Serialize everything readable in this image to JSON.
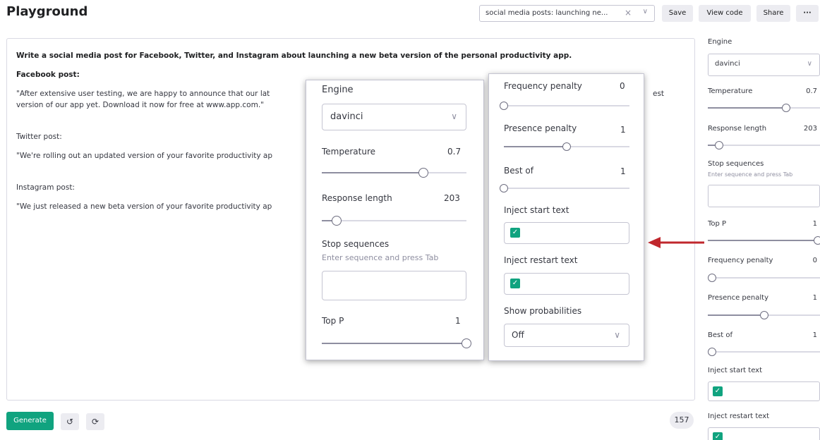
{
  "header": {
    "title": "Playground",
    "preset_value": "social media posts: launching ne...",
    "save_label": "Save",
    "view_code_label": "View code",
    "share_label": "Share",
    "more_label": "···"
  },
  "prompt": {
    "instruction": "Write a social media post for Facebook, Twitter, and Instagram about launching a new beta version of the personal productivity app.",
    "facebook_heading": "Facebook post:",
    "facebook_text_1": "\"After extensive user testing, we are happy to announce that our lat",
    "facebook_text_1_end": "est",
    "facebook_text_2": "version of our app yet. Download it now for free at www.app.com.\"",
    "twitter_heading": "Twitter post:",
    "twitter_text": "\"We're rolling out an updated version of your favorite productivity ap",
    "instagram_heading": "Instagram post:",
    "instagram_text": "\"We just released a new beta version of your favorite productivity ap"
  },
  "footer": {
    "generate_label": "Generate",
    "token_count": "157"
  },
  "sidebar": {
    "engine_label": "Engine",
    "engine_value": "davinci",
    "temperature_label": "Temperature",
    "temperature_value": "0.7",
    "response_length_label": "Response length",
    "response_length_value": "203",
    "stop_sequences_label": "Stop sequences",
    "stop_sequences_hint": "Enter sequence and press Tab",
    "top_p_label": "Top P",
    "top_p_value": "1",
    "frequency_penalty_label": "Frequency penalty",
    "frequency_penalty_value": "0",
    "presence_penalty_label": "Presence penalty",
    "presence_penalty_value": "1",
    "best_of_label": "Best of",
    "best_of_value": "1",
    "inject_start_label": "Inject start text",
    "inject_restart_label": "Inject restart text"
  },
  "zoom_left": {
    "engine_label": "Engine",
    "engine_value": "davinci",
    "temperature_label": "Temperature",
    "temperature_value": "0.7",
    "response_length_label": "Response length",
    "response_length_value": "203",
    "stop_sequences_label": "Stop sequences",
    "stop_sequences_hint": "Enter sequence and press Tab",
    "top_p_label": "Top P",
    "top_p_value": "1"
  },
  "zoom_right": {
    "frequency_penalty_label": "Frequency penalty",
    "frequency_penalty_value": "0",
    "presence_penalty_label": "Presence penalty",
    "presence_penalty_value": "1",
    "best_of_label": "Best of",
    "best_of_value": "1",
    "inject_start_label": "Inject start text",
    "inject_restart_label": "Inject restart text",
    "show_probabilities_label": "Show probabilities",
    "show_probabilities_value": "Off"
  },
  "slider_levels": {
    "temperature": 0.7,
    "response_length": 0.1,
    "top_p": 1.0,
    "frequency_penalty": 0.0,
    "presence_penalty": 0.5,
    "best_of": 0.0
  },
  "colors": {
    "accent_green": "#10a37f",
    "arrow_red": "#c0272d"
  }
}
